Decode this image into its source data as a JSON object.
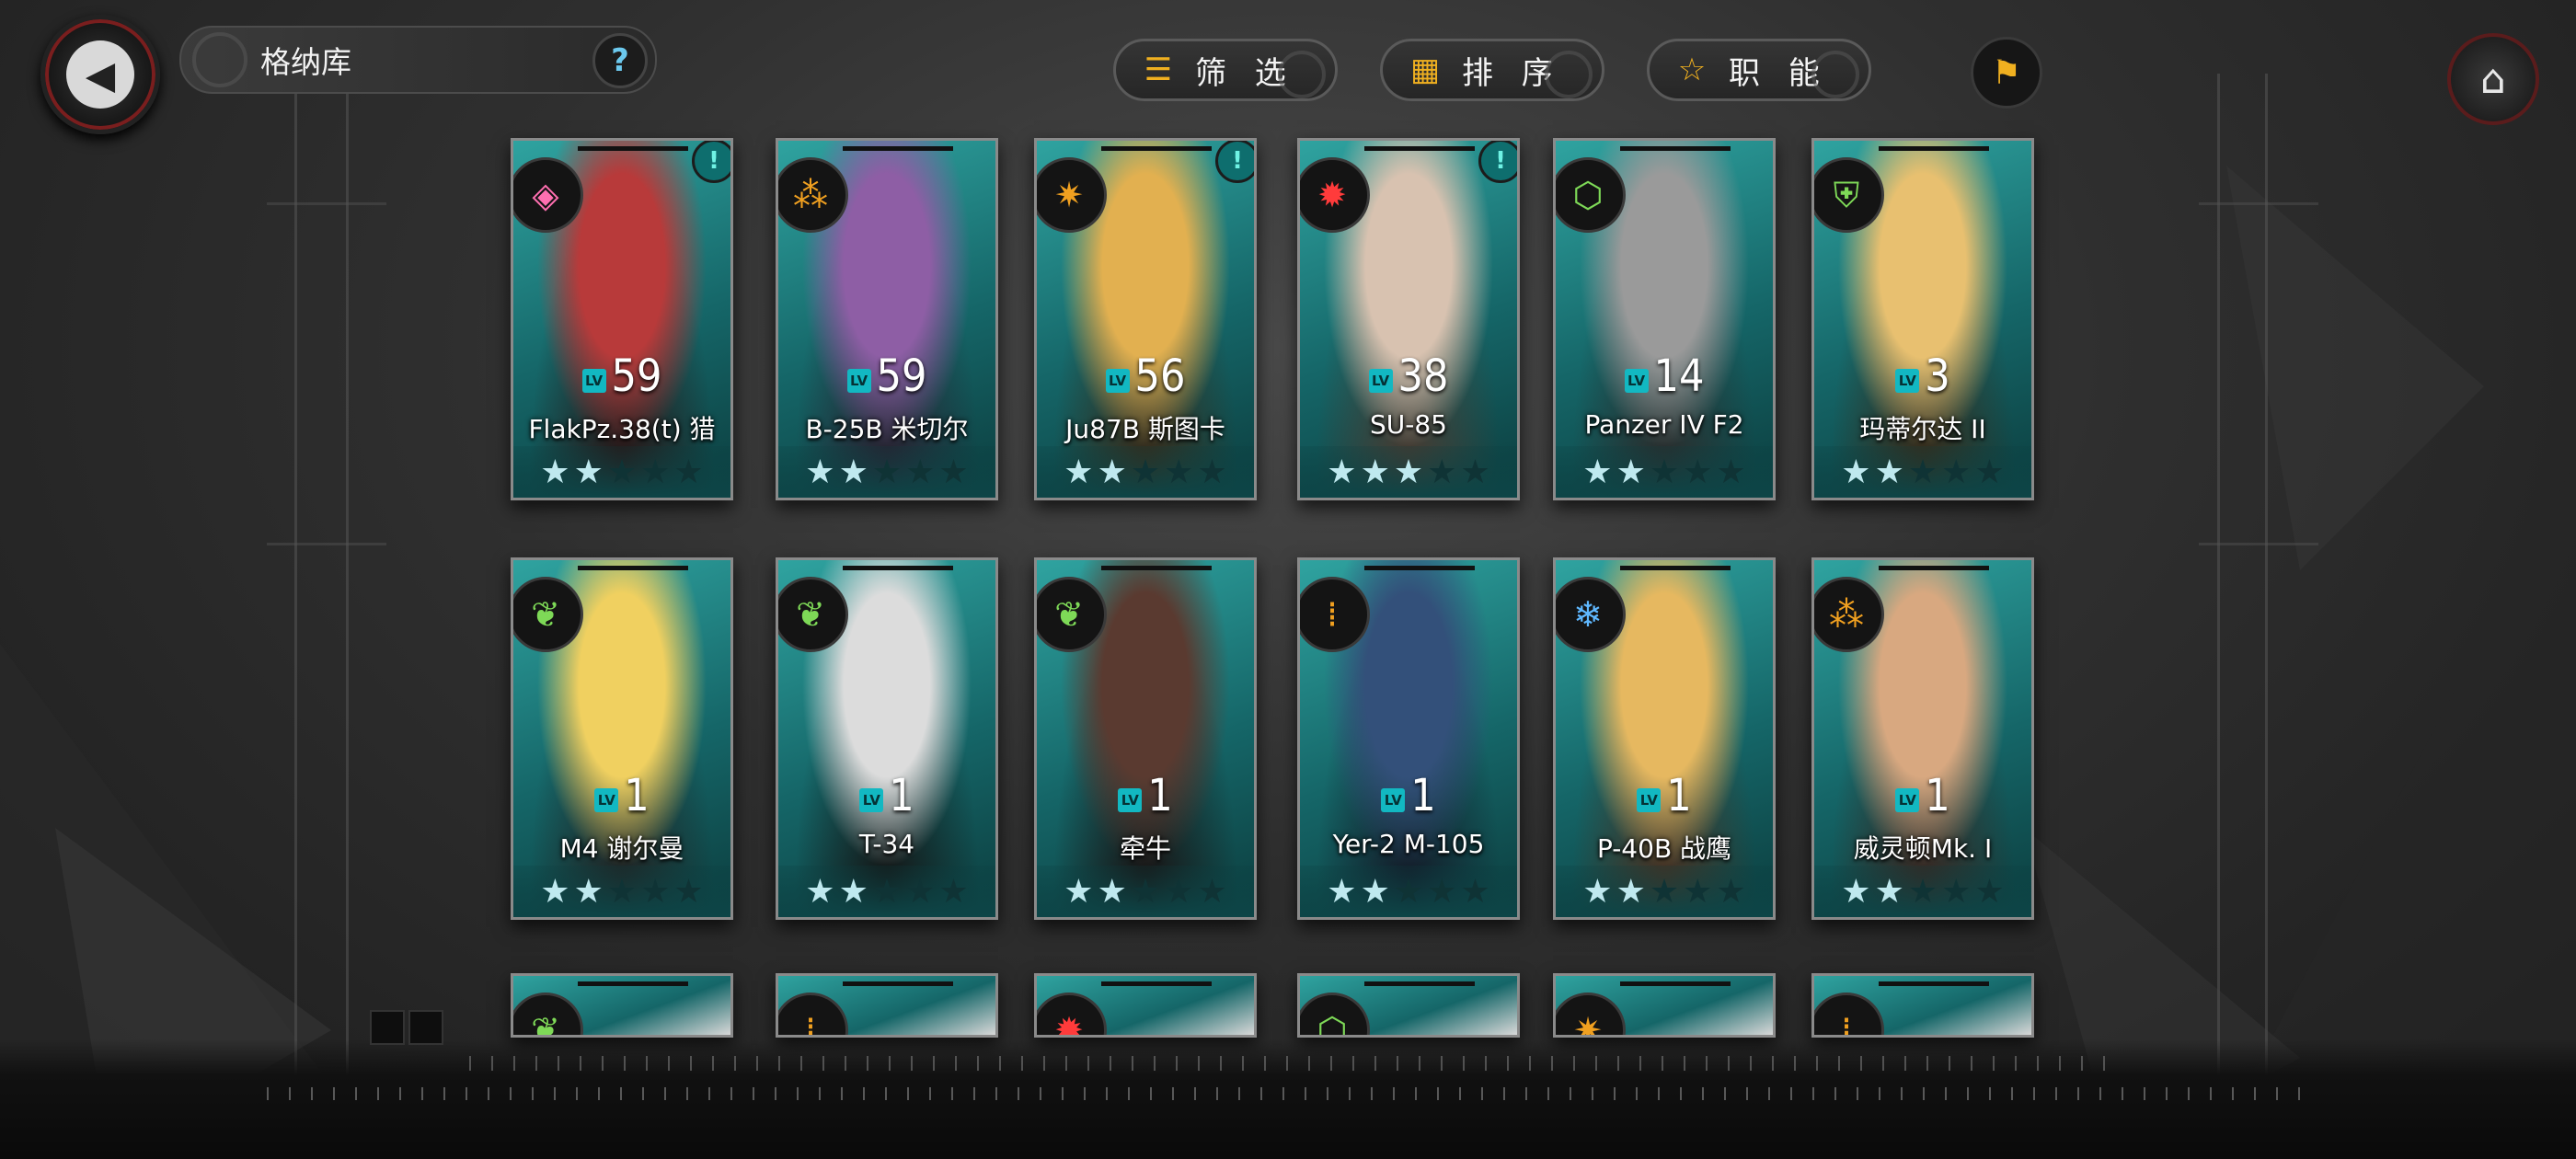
{
  "header": {
    "title": "格纳库",
    "help_label": "?",
    "back_icon": "back-arrow-icon",
    "home_icon": "home-icon"
  },
  "controls": {
    "filter_label": "筛 选",
    "sort_label": "排 序",
    "role_label": "职 能"
  },
  "colors": {
    "accent": "#f0b020",
    "card_bg": "#1f6f70",
    "level_tag": "#12b8c2"
  },
  "cards": [
    {
      "name": "FlakPz.38(t) 猎",
      "level": "59",
      "stars": 2,
      "alert": "!",
      "element_icon": "pink-diamond-icon"
    },
    {
      "name": "B-25B 米切尔",
      "level": "59",
      "stars": 2,
      "alert": "",
      "element_icon": "orange-triple-circle-icon"
    },
    {
      "name": "Ju87B 斯图卡",
      "level": "56",
      "stars": 2,
      "alert": "!",
      "element_icon": "orange-fan-icon"
    },
    {
      "name": "SU-85",
      "level": "38",
      "stars": 3,
      "alert": "!",
      "element_icon": "red-gear-icon"
    },
    {
      "name": "Panzer IV F2",
      "level": "14",
      "stars": 2,
      "alert": "",
      "element_icon": "green-hex-icon"
    },
    {
      "name": "玛蒂尔达 II",
      "level": "3",
      "stars": 2,
      "alert": "",
      "element_icon": "green-shield-icon"
    },
    {
      "name": "M4 谢尔曼",
      "level": "1",
      "stars": 2,
      "alert": "",
      "element_icon": "green-leaf-icon"
    },
    {
      "name": "T-34",
      "level": "1",
      "stars": 2,
      "alert": "",
      "element_icon": "green-leaf-icon"
    },
    {
      "name": "牵牛",
      "level": "1",
      "stars": 2,
      "alert": "",
      "element_icon": "green-leaf-icon"
    },
    {
      "name": "Yer-2 M-105",
      "level": "1",
      "stars": 2,
      "alert": "",
      "element_icon": "orange-ammo-icon"
    },
    {
      "name": "P-40B 战鹰",
      "level": "1",
      "stars": 2,
      "alert": "",
      "element_icon": "blue-snowflake-icon"
    },
    {
      "name": "威灵顿Mk. I",
      "level": "1",
      "stars": 2,
      "alert": "",
      "element_icon": "orange-triple-circle-icon"
    }
  ],
  "lv_tag": "LV"
}
